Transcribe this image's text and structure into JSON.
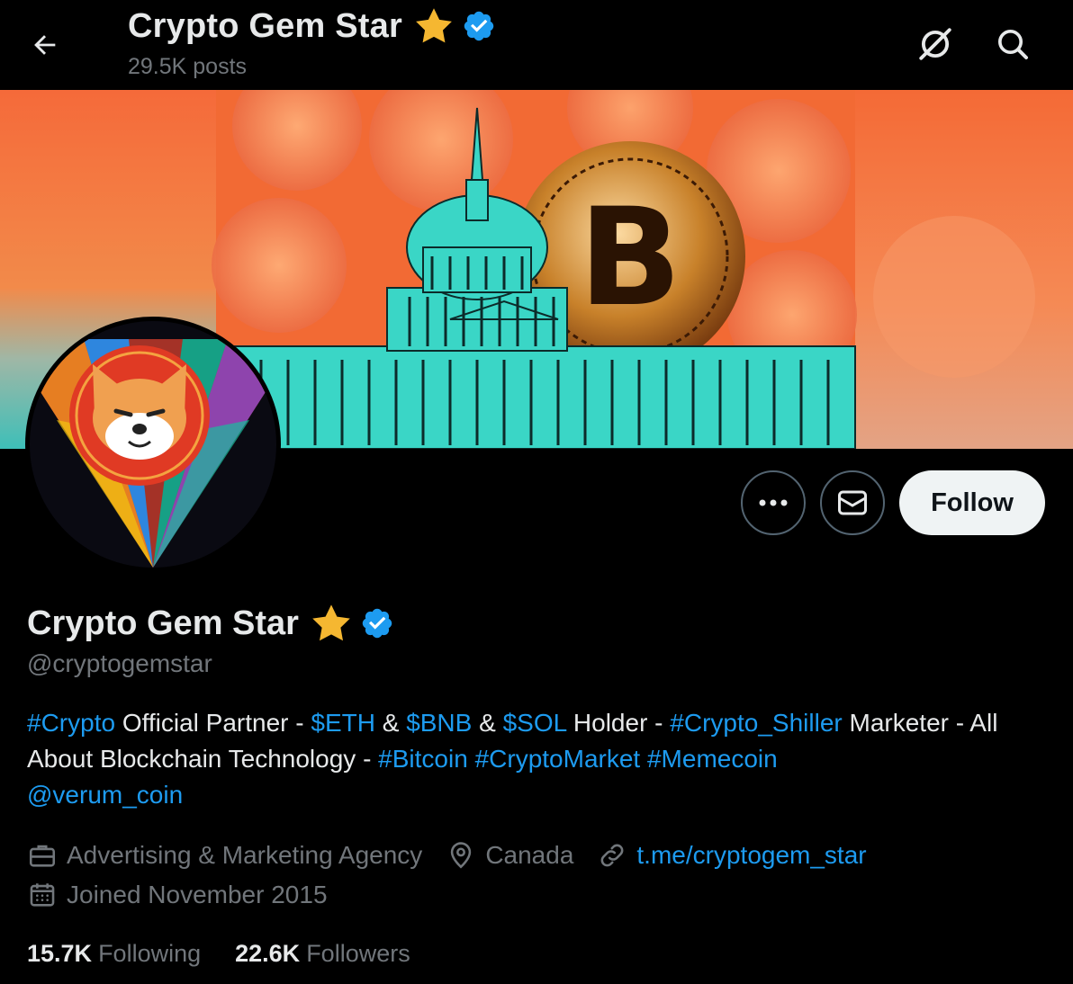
{
  "header": {
    "title": "Crypto Gem Star",
    "posts_count": "29.5K posts",
    "back_icon": "arrow-left-icon",
    "grok_icon": "grok-icon",
    "search_icon": "search-icon"
  },
  "profile": {
    "display_name": "Crypto Gem Star",
    "handle": "@cryptogemstar",
    "badge_emoji": "star",
    "verified": true,
    "bio": {
      "tag_crypto": "#Crypto",
      "text_1": " Official Partner - ",
      "cashtag_eth": "$ETH",
      "text_2": " & ",
      "cashtag_bnb": "$BNB",
      "text_3": " & ",
      "cashtag_sol": "$SOL",
      "text_4": " Holder - ",
      "tag_shiller": "#Crypto_Shiller",
      "text_5": " Marketer - All About Blockchain Technology - ",
      "tag_bitcoin": "#Bitcoin",
      "text_6": " ",
      "tag_market": "#CryptoMarket",
      "text_7": " ",
      "tag_memecoin": "#Memecoin",
      "mention": "@verum_coin"
    },
    "category": "Advertising & Marketing Agency",
    "location": "Canada",
    "website": "t.me/cryptogem_star",
    "joined": "Joined November 2015",
    "following_count": "15.7K",
    "following_label": "Following",
    "followers_count": "22.6K",
    "followers_label": "Followers"
  },
  "actions": {
    "more_icon": "more-dots-icon",
    "message_icon": "envelope-icon",
    "follow_label": "Follow"
  },
  "colors": {
    "accent": "#1d9bf0",
    "muted": "#71767b",
    "text": "#e7e9ea",
    "star": "#f5b731",
    "banner_orange": "#f0703a",
    "banner_teal": "#3fd6c8"
  }
}
